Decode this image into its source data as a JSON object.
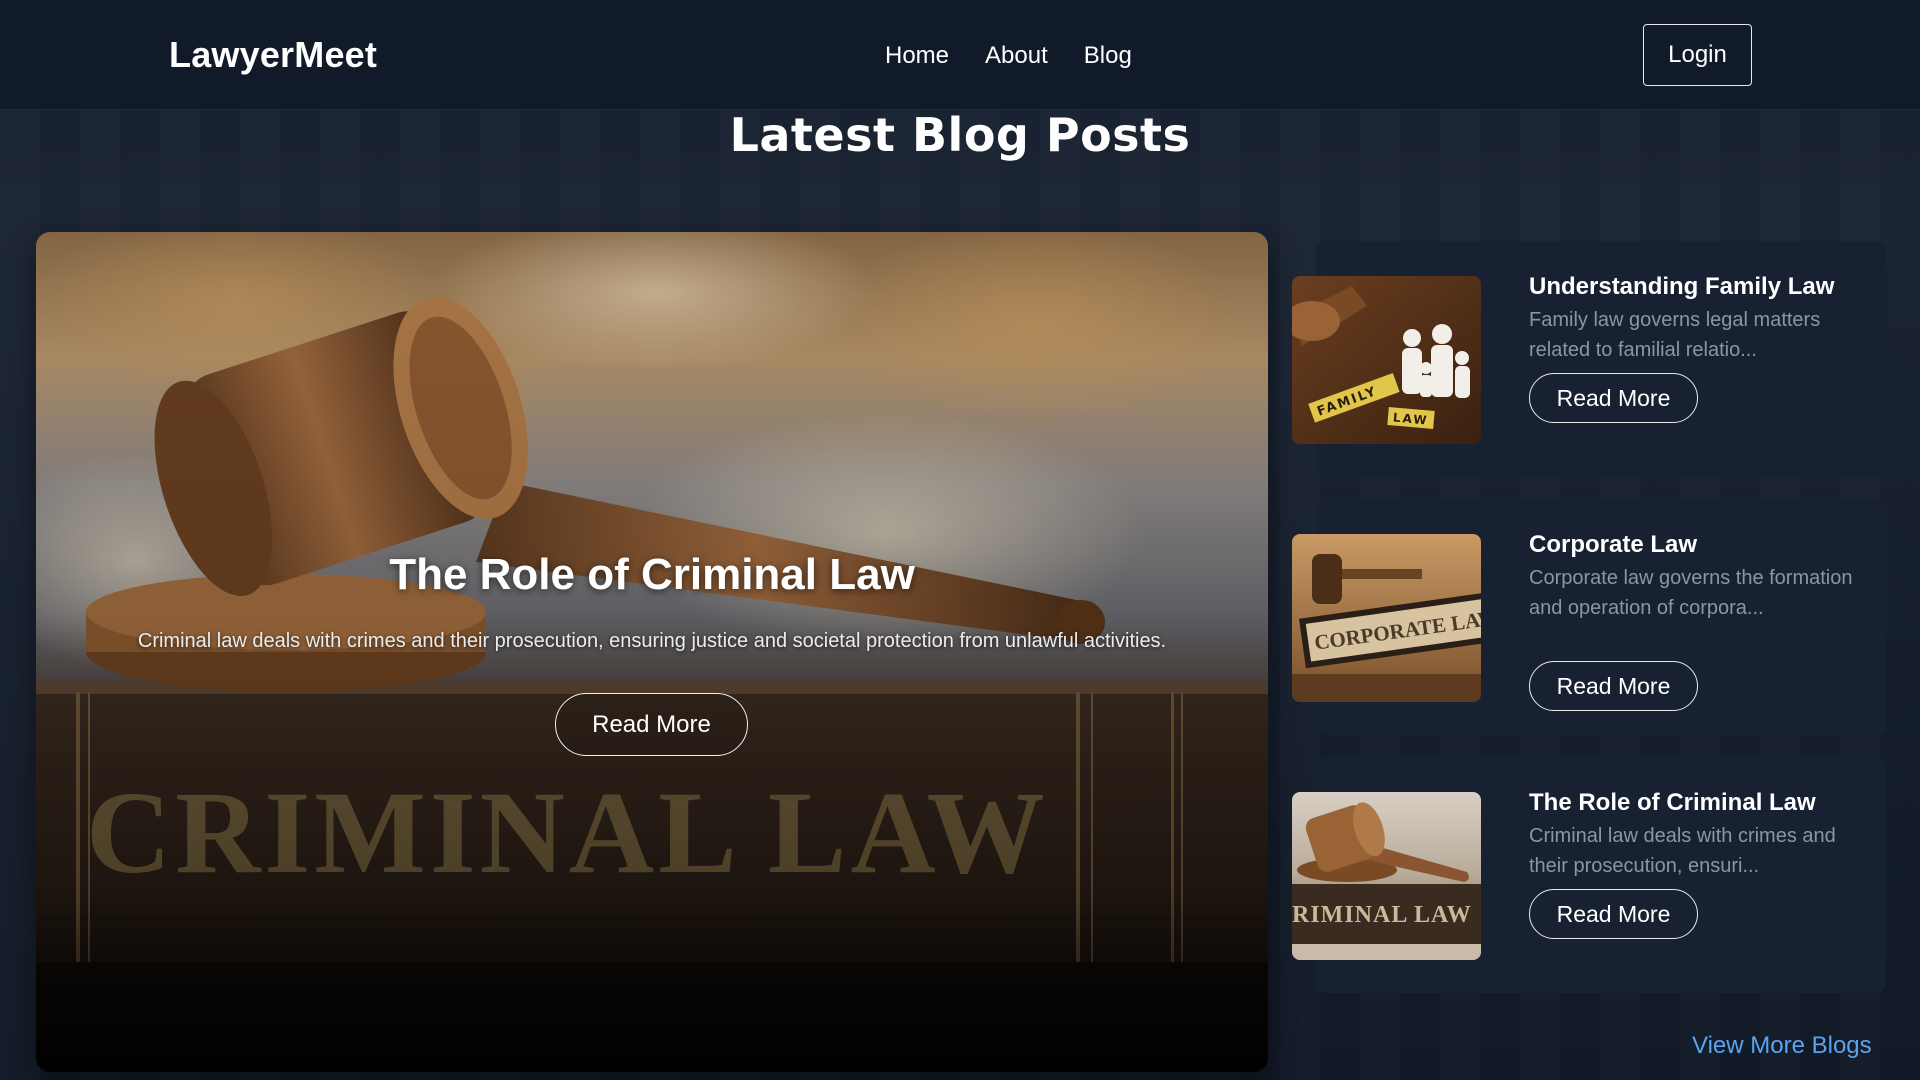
{
  "header": {
    "logo": "LawyerMeet",
    "nav": [
      "Home",
      "About",
      "Blog"
    ],
    "login_label": "Login"
  },
  "section_title": "Latest Blog Posts",
  "featured": {
    "title": "The Role of Criminal Law",
    "description": "Criminal law deals with crimes and their prosecution, ensuring justice and societal protection from unlawful activities.",
    "read_more": "Read More",
    "image_text": "CRIMINAL LAW"
  },
  "posts": [
    {
      "title": "Understanding Family Law",
      "excerpt": "Family law governs legal matters related to familial relatio...",
      "read_more": "Read More",
      "thumb_text": [
        "FAMILY",
        "LAW"
      ]
    },
    {
      "title": "Corporate Law",
      "excerpt": "Corporate law governs the formation and operation of corpora...",
      "read_more": "Read More",
      "thumb_text": [
        "CORPORATE LAW"
      ]
    },
    {
      "title": "The Role of Criminal Law",
      "excerpt": "Criminal law deals with crimes and their prosecution, ensuri...",
      "read_more": "Read More",
      "thumb_text": [
        "RIMINAL LAW"
      ]
    }
  ],
  "view_more": "View More Blogs",
  "colors": {
    "header_bg": "#111a29",
    "page_bg": "#17202f",
    "card_bg": "#172132",
    "excerpt": "#8d95a3",
    "link": "#5aa4ef"
  }
}
